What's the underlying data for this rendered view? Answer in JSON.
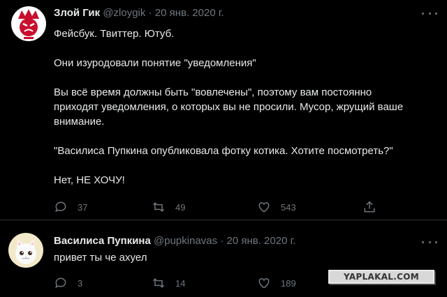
{
  "tweets": [
    {
      "name": "Злой Гик",
      "handle": "@zloygik",
      "separator": "·",
      "date": "20 янв. 2020 г.",
      "lines": [
        "Фейсбук. Твиттер. Ютуб.",
        "",
        "Они изуродовали понятие \"уведомления\"",
        "",
        "Вы всё время должны быть \"вовлечены\", поэтому вам постоянно",
        "приходят уведомления, о которых вы не просили. Мусор, жрущий ваше",
        "внимание.",
        "",
        "\"Василиса Пупкина опубликовала фотку котика. Хотите посмотреть?\"",
        "",
        "Нет, НЕ ХОЧУ!"
      ],
      "replies": "37",
      "retweets": "49",
      "likes": "543",
      "avatar_icon": "angry-crown-avatar-icon"
    },
    {
      "name": "Василиса Пупкина",
      "handle": "@pupkinavas",
      "separator": "·",
      "date": "20 янв. 2020 г.",
      "lines": [
        "привет ты че ахуел"
      ],
      "replies": "3",
      "retweets": "14",
      "likes": "189",
      "avatar_icon": "cat-avatar-icon"
    }
  ],
  "watermark": "YAPLAKAL.COM",
  "colors": {
    "background": "#000000",
    "text": "#e7e9ea",
    "muted": "#6e767d",
    "divider": "#2f3336"
  }
}
